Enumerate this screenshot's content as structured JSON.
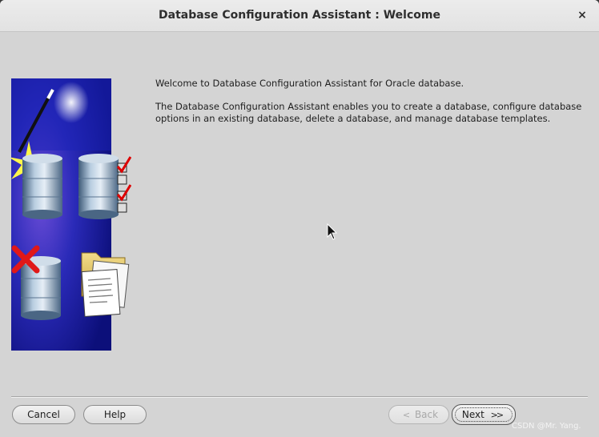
{
  "window": {
    "title": "Database Configuration Assistant : Welcome",
    "close_glyph": "×"
  },
  "main": {
    "welcome_line": "Welcome to Database Configuration Assistant for Oracle database.",
    "description": "The Database Configuration Assistant enables you to create a database, configure database options in an existing database, delete a database, and manage database templates."
  },
  "buttons": {
    "cancel": "Cancel",
    "help": "Help",
    "back": "Back",
    "next": "Next",
    "back_arrow": "<",
    "next_arrow": ">>"
  },
  "watermark": "CSDN @Mr. Yang.",
  "icons": {
    "image": "database-wizard-illustration",
    "cursor": "mouse-pointer-icon"
  },
  "colors": {
    "background": "#d4d4d4",
    "titlebar": "#e8e8e8",
    "illustration_blue": "#1a1f9c"
  }
}
